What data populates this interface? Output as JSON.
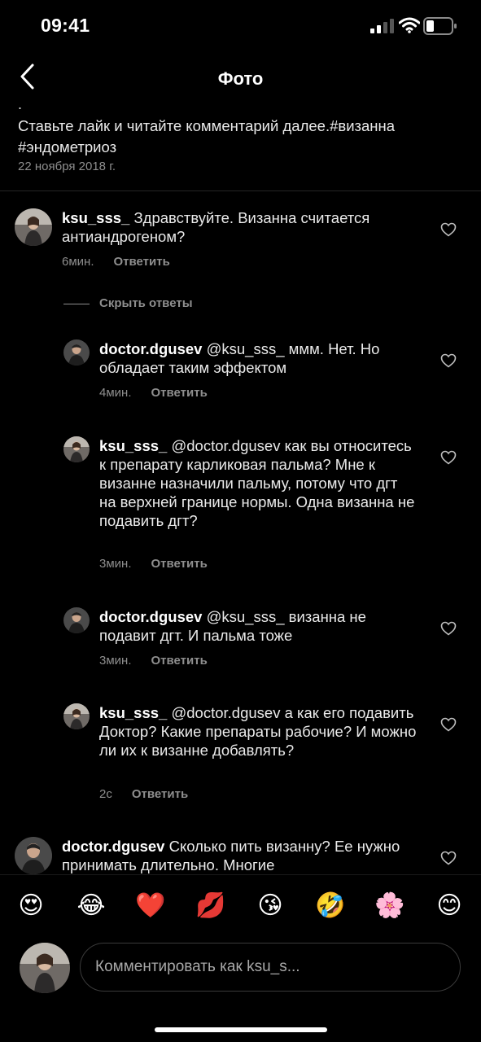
{
  "status": {
    "time": "09:41"
  },
  "nav": {
    "title": "Фото"
  },
  "caption": {
    "dot": ".",
    "text": "Ставьте лайк и читайте комментарий далее.#визанна #эндометриоз",
    "date": "22 ноября 2018 г."
  },
  "comments": [
    {
      "user": "ksu_sss_",
      "text": "Здравствуйте. Визанна считается антиандрогеном?",
      "time": "6мин.",
      "reply": "Ответить"
    },
    {
      "user": "doctor.dgusev",
      "text": "@ksu_sss_ ммм. Нет. Но обладает таким эффектом",
      "time": "4мин.",
      "reply": "Ответить"
    },
    {
      "user": "ksu_sss_",
      "text": "@doctor.dgusev как вы относитесь к препарату карликовая пальма? Мне к визанне назначили пальму, потому что дгт на верхней границе нормы. Одна визанна не подавить дгт?",
      "time": "3мин.",
      "reply": "Ответить"
    },
    {
      "user": "doctor.dgusev",
      "text": "@ksu_sss_ визанна не подавит дгт. И пальма тоже",
      "time": "3мин.",
      "reply": "Ответить"
    },
    {
      "user": "ksu_sss_",
      "text": "@doctor.dgusev а как его подавить Доктор? Какие препараты рабочие? И можно ли их к визанне добавлять?",
      "time": "2с",
      "reply": "Ответить"
    },
    {
      "user": "doctor.dgusev",
      "text": "Сколько пить визанну? Ее нужно принимать длительно. Многие"
    }
  ],
  "hide_replies": "Скрыть ответы",
  "emojis": [
    "😍",
    "😂",
    "❤️",
    "💋",
    "😘",
    "🤣",
    "🌸",
    "😊"
  ],
  "composer": {
    "placeholder": "Комментировать как ksu_s..."
  },
  "colors": {
    "background": "#000000",
    "secondary_text": "#8e8e8e",
    "heart": "#ed4956"
  }
}
